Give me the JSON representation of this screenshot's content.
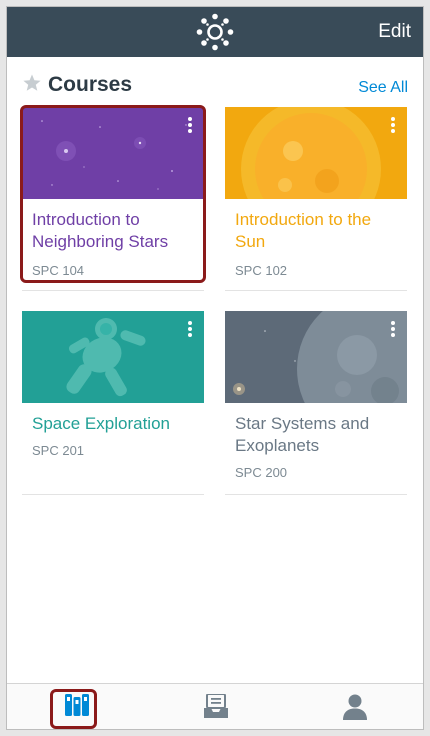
{
  "header": {
    "edit_label": "Edit",
    "logo_icon": "canvas-logo-icon",
    "background": "#394b58"
  },
  "courses_section": {
    "title": "Courses",
    "star_icon": "star-icon",
    "see_all_label": "See All"
  },
  "courses": [
    {
      "name": "Introduction to Neighboring Stars",
      "code": "SPC 104",
      "color": "#6f3fa6",
      "selected": true
    },
    {
      "name": "Introduction to the Sun",
      "code": "SPC 102",
      "color": "#f2a80f",
      "selected": false
    },
    {
      "name": "Space Exploration",
      "code": "SPC 201",
      "color": "#22a096",
      "selected": false
    },
    {
      "name": "Star Systems and Exoplanets",
      "code": "SPC 200",
      "color": "#6a7885",
      "selected": false
    }
  ],
  "tabbar": {
    "tabs": [
      {
        "icon": "dashboard-courses-icon",
        "label": "",
        "active": true
      },
      {
        "icon": "inbox-icon",
        "label": "",
        "active": false
      },
      {
        "icon": "profile-icon",
        "label": "",
        "active": false
      }
    ],
    "active_color": "#0089d6",
    "inactive_color": "#73818c"
  }
}
